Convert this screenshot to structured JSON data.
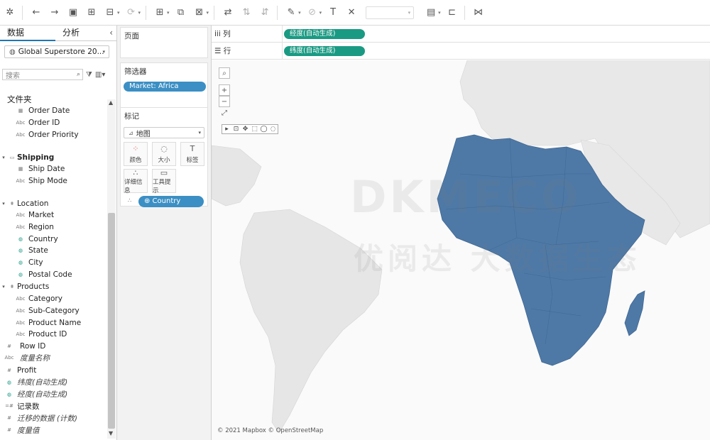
{
  "toolbar": {
    "items": [
      "tableau-logo-icon",
      "undo-icon",
      "redo-icon",
      "save-icon",
      "new-datasource-icon",
      "pause-updates-icon",
      "refresh-icon",
      "new-worksheet-icon",
      "duplicate-icon",
      "clear-sheet-icon",
      "swap-icon",
      "sort-asc-icon",
      "sort-desc-icon",
      "highlight-icon",
      "group-icon",
      "label-icon",
      "fix-axes-icon",
      "fit-icon",
      "show-cards-icon",
      "presentation-icon",
      "share-icon"
    ]
  },
  "data_pane": {
    "tab_data": "数据",
    "tab_analysis": "分析",
    "datasource": "Global Superstore 20...",
    "search_placeholder": "搜索",
    "folder_label": "文件夹",
    "fields": [
      {
        "label": "Order Date",
        "icon": "calendar-icon",
        "glyph": "▦"
      },
      {
        "label": "Order ID",
        "icon": "abc-icon",
        "glyph": "Abc"
      },
      {
        "label": "Order Priority",
        "icon": "abc-icon",
        "glyph": "Abc"
      }
    ],
    "shipping_group": "Shipping",
    "shipping_fields": [
      {
        "label": "Ship Date",
        "icon": "calendar-icon",
        "glyph": "▦"
      },
      {
        "label": "Ship Mode",
        "icon": "abc-icon",
        "glyph": "Abc"
      }
    ],
    "location_group": "Location",
    "location_fields": [
      {
        "label": "Market",
        "icon": "abc-icon",
        "glyph": "Abc"
      },
      {
        "label": "Region",
        "icon": "abc-icon",
        "glyph": "Abc"
      },
      {
        "label": "Country",
        "icon": "globe-icon",
        "glyph": "◍"
      },
      {
        "label": "State",
        "icon": "globe-icon",
        "glyph": "◍"
      },
      {
        "label": "City",
        "icon": "globe-icon",
        "glyph": "◍"
      },
      {
        "label": "Postal Code",
        "icon": "globe-icon",
        "glyph": "◍"
      }
    ],
    "products_group": "Products",
    "products_fields": [
      {
        "label": "Category",
        "icon": "abc-icon",
        "glyph": "Abc"
      },
      {
        "label": "Sub-Category",
        "icon": "abc-icon",
        "glyph": "Abc"
      },
      {
        "label": "Product Name",
        "icon": "abc-icon",
        "glyph": "Abc"
      },
      {
        "label": "Product ID",
        "icon": "abc-icon",
        "glyph": "Abc"
      }
    ],
    "row_id": "Row ID",
    "measure_names": "度量名称",
    "measures": [
      {
        "label": "Profit",
        "icon": "number-icon",
        "glyph": "#"
      },
      {
        "label": "纬度(自动生成)",
        "icon": "globe-icon",
        "glyph": "◍"
      },
      {
        "label": "经度(自动生成)",
        "icon": "globe-icon",
        "glyph": "◍"
      },
      {
        "label": "记录数",
        "icon": "number-icon",
        "glyph": "=#"
      },
      {
        "label": "迁移的数据 (计数)",
        "icon": "number-icon",
        "glyph": "#"
      },
      {
        "label": "度量值",
        "icon": "number-icon",
        "glyph": "#"
      }
    ]
  },
  "cards": {
    "pages_title": "页面",
    "filters_title": "筛选器",
    "filter_pill": "Market: Africa",
    "marks_title": "标记",
    "marks_type": "地图",
    "mark_buttons": [
      {
        "label": "颜色",
        "icon": "color-icon",
        "glyph": "⁘"
      },
      {
        "label": "大小",
        "icon": "size-icon",
        "glyph": "◌"
      },
      {
        "label": "标签",
        "icon": "label-icon",
        "glyph": "T"
      },
      {
        "label": "详细信息",
        "icon": "detail-icon",
        "glyph": "∴"
      },
      {
        "label": "工具提示",
        "icon": "tooltip-icon",
        "glyph": "▭"
      }
    ],
    "detail_pill": "⊕ Country"
  },
  "shelves": {
    "columns_label": "iii 列",
    "columns_pill": "经度(自动生成)",
    "rows_label": "☰ 行",
    "rows_pill": "纬度(自动生成)"
  },
  "map": {
    "attribution": "© 2021 Mapbox © OpenStreetMap",
    "watermark_line1": "DKMECO",
    "watermark_line2": "优阅达 大数据生态",
    "highlight_color": "#4e79a7",
    "land_color": "#e9e9e9"
  }
}
